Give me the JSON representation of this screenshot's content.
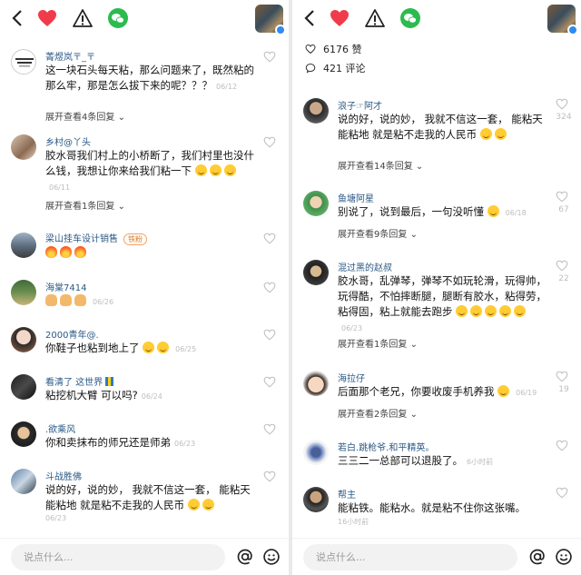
{
  "input_placeholder": "说点什么...",
  "left": {
    "comments": [
      {
        "name": "菁煜岚〒_〒",
        "text": "这一块石头每天粘，那么问题来了，既然粘的那么牢，那是怎么拔下来的呢？？？",
        "date": "06/12",
        "expand": "展开查看4条回复"
      },
      {
        "name": "乡村@丫头",
        "text": "胶水哥我们村上的小桥断了，我们村里也没什么钱，我想让你来给我们粘一下",
        "date": "06/11",
        "expand": "展开查看1条回复"
      },
      {
        "name": "梁山挂车设计销售",
        "tag": "铁粉",
        "text": "",
        "date": ""
      },
      {
        "name": "海棠7414",
        "text": "",
        "date": "06/26"
      },
      {
        "name": "2000青年@.",
        "text": "你鞋子也粘到地上了",
        "date": "06/25"
      },
      {
        "name": "看清了 这世界",
        "text": "粘挖机大臂   可以吗?",
        "date": "06/24"
      },
      {
        "name": ".欲乘风",
        "text": "你和卖抹布的师兄还是师弟",
        "date": "06/23"
      },
      {
        "name": "斗战胜佛",
        "text": "说的好，说的妙，  我就不信这一套，  能粘天能粘地 就是粘不走我的人民币",
        "date": "06/23"
      }
    ]
  },
  "right": {
    "likes": "6176 赞",
    "comments_count": "421 评论",
    "comments": [
      {
        "name": "浪子☞阿才",
        "text": "说的好，说的妙，  我就不信这一套，  能粘天能粘地 就是粘不走我的人民币",
        "date": "",
        "likes": "324",
        "expand": "展开查看14条回复"
      },
      {
        "name": "鱼塘阿星",
        "text": "别说了，说到最后，一句没听懂",
        "date": "06/18",
        "likes": "67",
        "expand": "展开查看9条回复"
      },
      {
        "name": "混过黑的赵叔",
        "text": "胶水哥，乱弹琴，弹琴不如玩轮滑，玩得帅，玩得酷，不怕摔断腿，腿断有胶水，粘得劳，粘得固，粘上就能去跑步",
        "date": "06/23",
        "likes": "22",
        "expand": "展开查看1条回复"
      },
      {
        "name": "海拉仔",
        "text": "后面那个老兄，你要收废手机养我",
        "date": "06/19",
        "likes": "19",
        "expand": "展开查看2条回复"
      },
      {
        "name": "若白.跳枪爷.和平精英。",
        "text": "三三二一总部可以退股了。",
        "date": "6小时前"
      },
      {
        "name": "帮主",
        "text": "能粘铁。能粘水。就是粘不住你这张嘴。",
        "date": "16小时前"
      }
    ]
  }
}
